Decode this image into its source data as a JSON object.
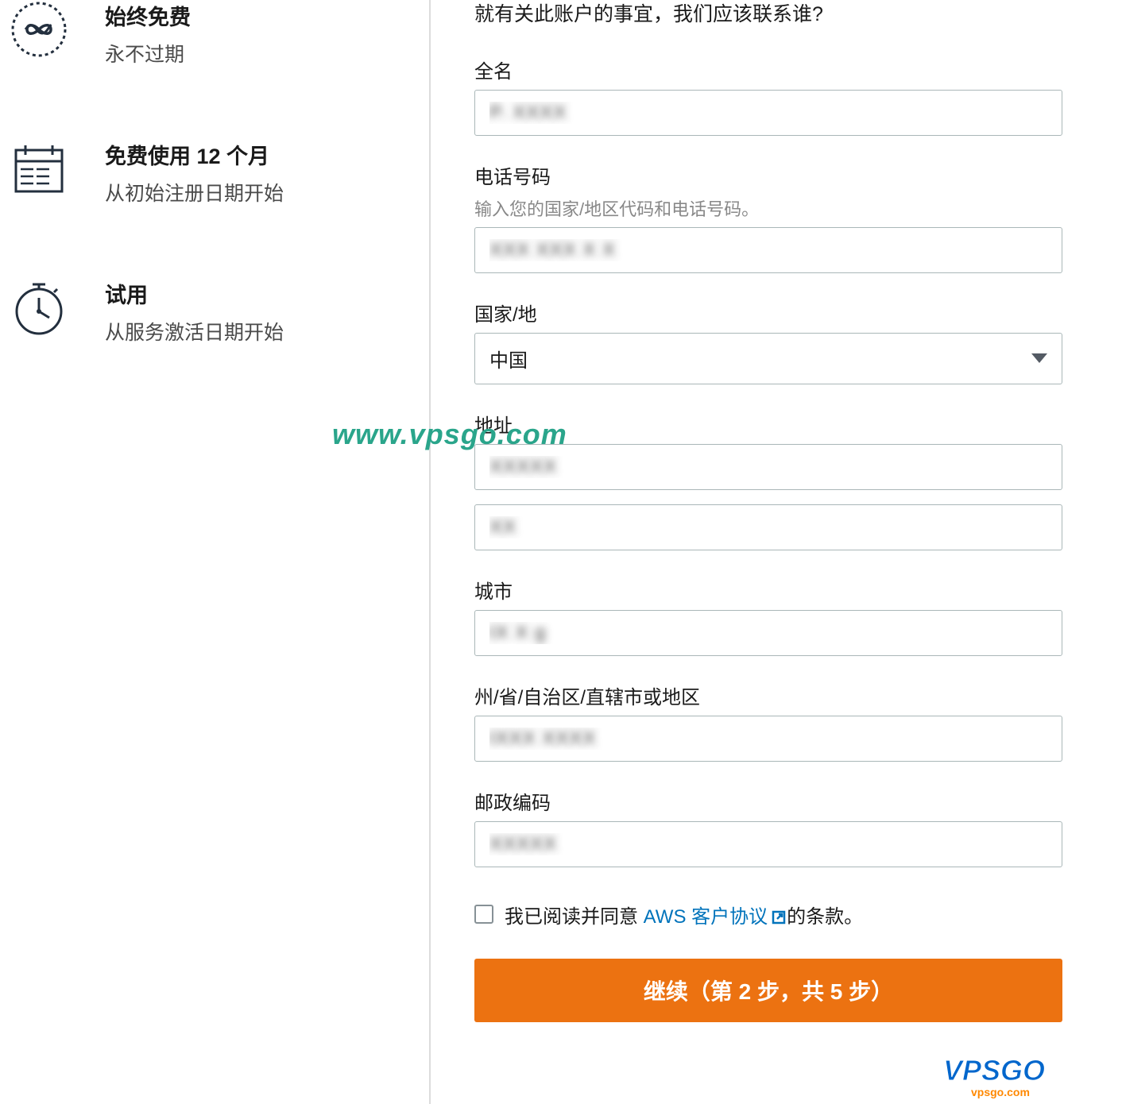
{
  "features": [
    {
      "title": "始终免费",
      "description": "永不过期"
    },
    {
      "title": "免费使用 12 个月",
      "description": "从初始注册日期开始"
    },
    {
      "title": "试用",
      "description": "从服务激活日期开始"
    }
  ],
  "form": {
    "header": "就有关此账户的事宜，我们应该联系谁?",
    "fullname": {
      "label": "全名",
      "value": "P. XXXX"
    },
    "phone": {
      "label": "电话号码",
      "hint": "输入您的国家/地区代码和电话号码。",
      "value": "XXX XXX X X"
    },
    "country": {
      "label": "国家/地",
      "value": "中国"
    },
    "address": {
      "label": "地址",
      "value1": "XXXXX",
      "value2": "XX"
    },
    "city": {
      "label": "城市",
      "value": "IX X g"
    },
    "state": {
      "label": "州/省/自治区/直辖市或地区",
      "value": "IXXX XXXX"
    },
    "postal": {
      "label": "邮政编码",
      "value": "XXXXX"
    },
    "agreement": {
      "prefix": "我已阅读并同意 ",
      "link": "AWS 客户协议",
      "suffix": "的条款。"
    },
    "continue_button": "继续（第 2 步，共 5 步）"
  },
  "watermark": "www.vpsgo.com"
}
